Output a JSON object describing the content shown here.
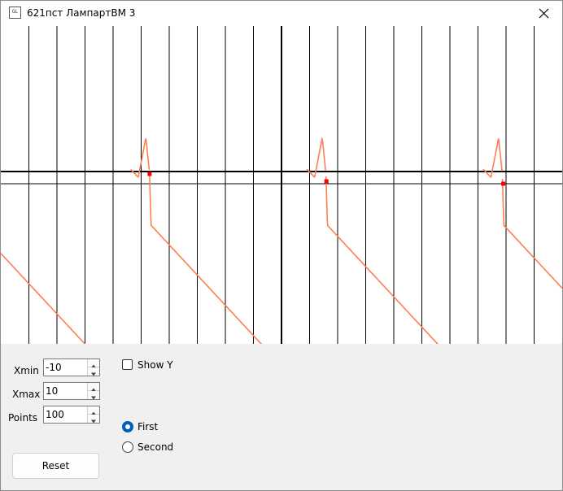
{
  "window": {
    "title": "621пст ЛампартВМ 3",
    "app_icon_text": "GL"
  },
  "graph": {
    "curve_color": "#ff7f50",
    "marker_color": "#ff0000",
    "grid_color": "#000000",
    "x_range": [
      -10,
      10
    ],
    "markers": [
      {
        "x": -4.7,
        "y": -0.05
      },
      {
        "x": 1.6,
        "y": -0.2
      },
      {
        "x": 7.9,
        "y": -0.25
      }
    ]
  },
  "controls": {
    "xmin": {
      "label": "Xmin",
      "value": "-10"
    },
    "xmax": {
      "label": "Xmax",
      "value": "10"
    },
    "points": {
      "label": "Points",
      "value": "100"
    },
    "show_y": {
      "label": "Show Y",
      "checked": false
    },
    "mode": {
      "options": [
        {
          "label": "First",
          "selected": true
        },
        {
          "label": "Second",
          "selected": false
        }
      ]
    },
    "reset_label": "Reset"
  }
}
